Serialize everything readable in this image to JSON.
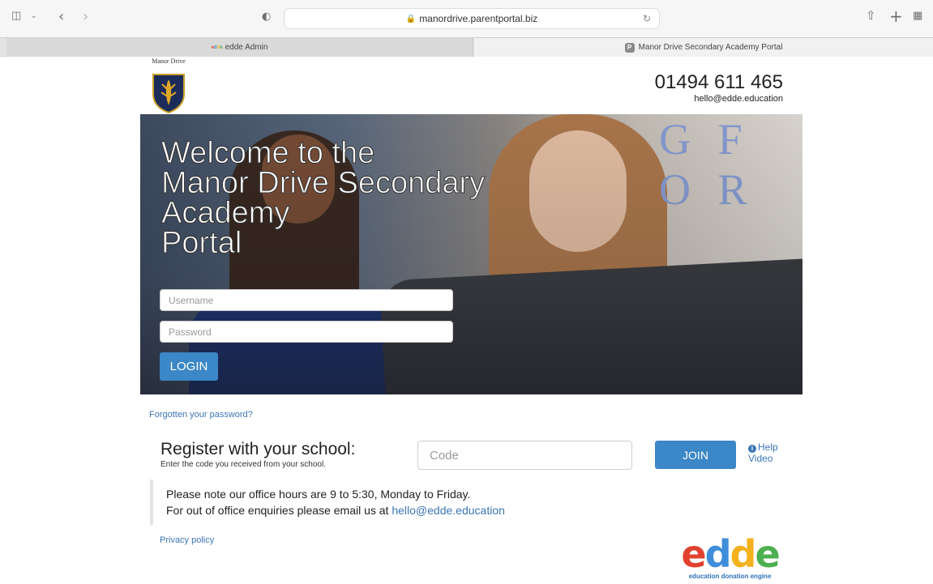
{
  "browser": {
    "url": "manordrive.parentportal.biz",
    "tabs": [
      {
        "label": "edde Admin"
      },
      {
        "label": "Manor Drive Secondary Academy Portal"
      }
    ]
  },
  "header": {
    "crest_text": "Manor Drive",
    "phone": "01494 611 465",
    "email": "hello@edde.education"
  },
  "hero": {
    "title_lines": [
      "Welcome to the",
      "Manor Drive Secondary",
      "Academy",
      "Portal"
    ],
    "username_placeholder": "Username",
    "password_placeholder": "Password",
    "login_label": "LOGIN"
  },
  "forgot_label": "Forgotten your password?",
  "register": {
    "title": "Register with your school:",
    "subtitle": "Enter the code you received from your school.",
    "code_placeholder": "Code",
    "join_label": "JOIN",
    "help_label": "Help Video"
  },
  "note": {
    "line1": "Please note our office hours are 9 to 5:30, Monday to Friday.",
    "line2_prefix": "For out of office enquiries please email us at ",
    "line2_email": "hello@edde.education"
  },
  "privacy_label": "Privacy policy",
  "logo": {
    "letters": [
      "e",
      "d",
      "d",
      "e"
    ],
    "tagline": "education donation engine"
  },
  "colors": {
    "accent": "#3b87c7",
    "link": "#3b76b5",
    "logo_letters": [
      "#e2412f",
      "#3f8ddb",
      "#f4b11e",
      "#4caf50"
    ]
  }
}
